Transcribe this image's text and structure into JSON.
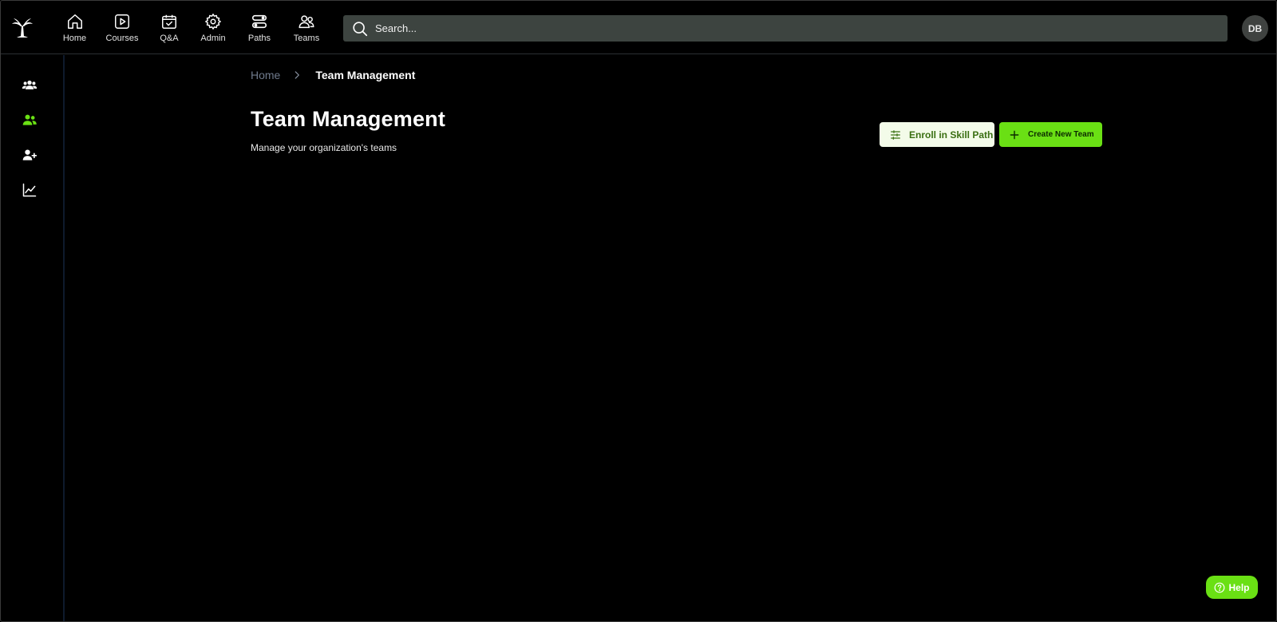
{
  "nav": {
    "items": [
      {
        "label": "Home",
        "icon": "home-icon"
      },
      {
        "label": "Courses",
        "icon": "play-square-icon"
      },
      {
        "label": "Q&A",
        "icon": "calendar-check-icon"
      },
      {
        "label": "Admin",
        "icon": "gear-icon"
      },
      {
        "label": "Paths",
        "icon": "paths-icon"
      },
      {
        "label": "Teams",
        "icon": "users-icon"
      }
    ]
  },
  "search": {
    "placeholder": "Search..."
  },
  "user": {
    "initials": "DB"
  },
  "sidebar": {
    "items": [
      {
        "icon": "team-group-icon",
        "active": false
      },
      {
        "icon": "users-icon",
        "active": true
      },
      {
        "icon": "user-plus-icon",
        "active": false
      },
      {
        "icon": "analytics-chart-icon",
        "active": false
      }
    ]
  },
  "breadcrumb": {
    "home": "Home",
    "current": "Team Management"
  },
  "page": {
    "title": "Team Management",
    "subtitle": "Manage your organization's teams"
  },
  "actions": {
    "enroll_label": "Enroll in Skill Path",
    "create_label": "Create New Team"
  },
  "help": {
    "label": "Help"
  },
  "colors": {
    "accent": "#6ae014",
    "accent_dark": "#3a6f12",
    "background": "#000000",
    "search_bg": "#3d4440"
  }
}
